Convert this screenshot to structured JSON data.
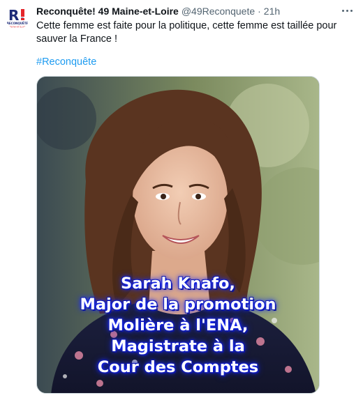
{
  "tweet": {
    "author_name": "Reconquête! 49 Maine-et-Loire",
    "handle": "@49Reconquete",
    "separator": "·",
    "time": "21h",
    "text": "Cette femme est faite pour la politique, cette femme est taillée pour sauver la France !",
    "hashtag": "#Reconquête",
    "avatar_logo": {
      "mark": "R!",
      "wordmark": "RECONQUÊTE",
      "subline": "Maine-et-Loire"
    },
    "media_caption": [
      "Sarah Knafo,",
      "Major de la promotion",
      "Molière à l'ENA,",
      "Magistrate à la",
      "Cour des Comptes"
    ]
  },
  "icons": {
    "more": "more-horizontal-icon"
  },
  "colors": {
    "accent": "#1d9bf0",
    "text": "#0f1419",
    "muted": "#536471",
    "caption_glow": "#1a2cff"
  }
}
